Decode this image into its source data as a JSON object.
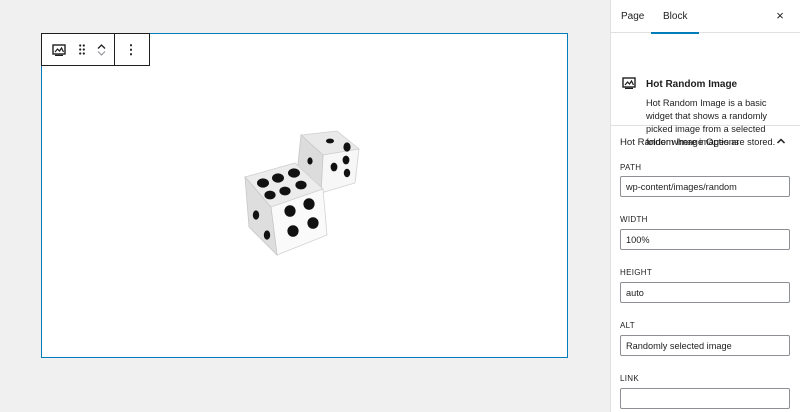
{
  "sidebar": {
    "tabs": [
      {
        "label": "Page"
      },
      {
        "label": "Block"
      }
    ],
    "close_label": "×",
    "block_card": {
      "icon": "widget-image-icon",
      "title": "Hot Random Image",
      "description": "Hot Random Image is a basic widget that shows a randomly picked image from a selected folder where images are stored."
    },
    "panel": {
      "title": "Hot Random Image Options",
      "fields": [
        {
          "label": "PATH",
          "value": "wp-content/images/random"
        },
        {
          "label": "WIDTH",
          "value": "100%"
        },
        {
          "label": "HEIGHT",
          "value": "auto"
        },
        {
          "label": "ALT",
          "value": "Randomly selected image"
        },
        {
          "label": "LINK",
          "value": ""
        }
      ]
    }
  },
  "toolbar": {
    "block_icon": "widget-image-icon",
    "drag_icon": "drag-handle-icon",
    "move_up_icon": "chevron-up-icon",
    "move_down_icon": "chevron-down-icon",
    "more_label": "⋮"
  },
  "block": {
    "image": "dice-image"
  },
  "colors": {
    "accent": "#007cba",
    "border": "#e0e0e0",
    "canvas_bg": "#f0f0f0"
  }
}
